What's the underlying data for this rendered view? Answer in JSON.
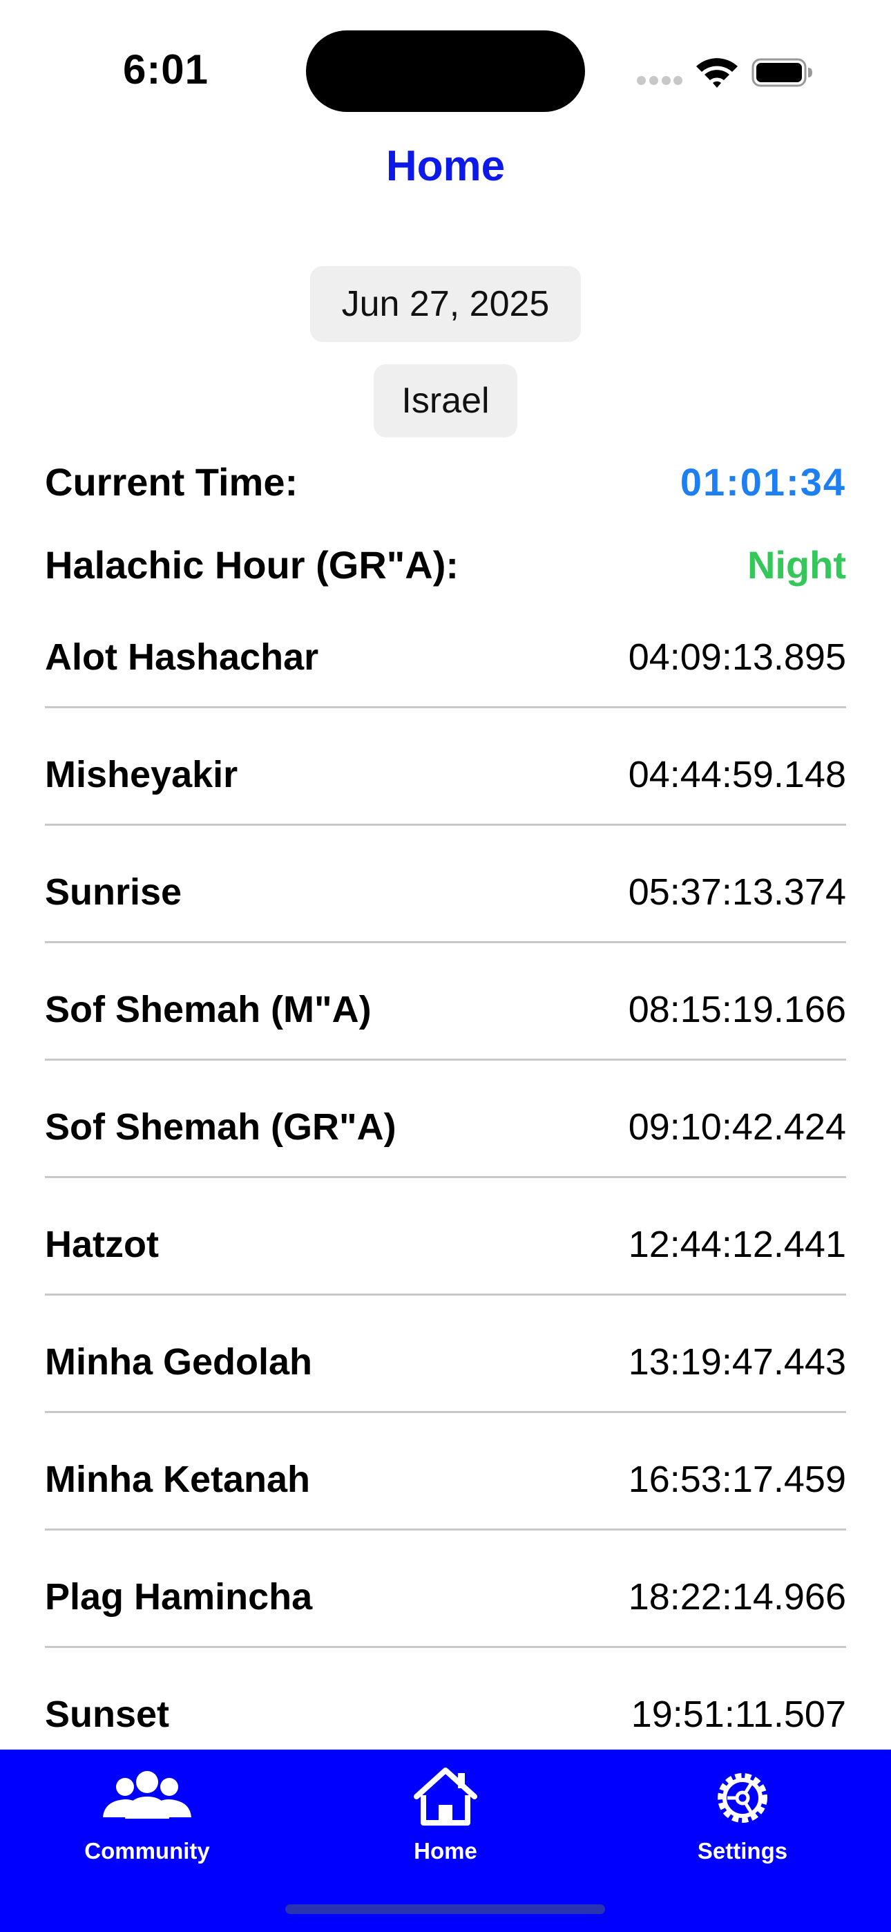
{
  "status_bar": {
    "time": "6:01"
  },
  "navigation": {
    "title": "Home"
  },
  "controls": {
    "date": "Jun 27, 2025",
    "region": "Israel"
  },
  "current_time": {
    "label": "Current Time:",
    "value": "01:01:34"
  },
  "halachic_hour": {
    "label": "Halachic Hour (GR\"A):",
    "value": "Night"
  },
  "zmanim": [
    {
      "name": "Alot Hashachar",
      "time": "04:09:13.895"
    },
    {
      "name": "Misheyakir",
      "time": "04:44:59.148"
    },
    {
      "name": "Sunrise",
      "time": "05:37:13.374"
    },
    {
      "name": "Sof Shemah (M\"A)",
      "time": "08:15:19.166"
    },
    {
      "name": "Sof Shemah (GR\"A)",
      "time": "09:10:42.424"
    },
    {
      "name": "Hatzot",
      "time": "12:44:12.441"
    },
    {
      "name": "Minha Gedolah",
      "time": "13:19:47.443"
    },
    {
      "name": "Minha Ketanah",
      "time": "16:53:17.459"
    },
    {
      "name": "Plag Hamincha",
      "time": "18:22:14.966"
    },
    {
      "name": "Sunset",
      "time": "19:51:11.507"
    }
  ],
  "tab_bar": {
    "tabs": [
      {
        "label": "Community",
        "icon": "community-icon"
      },
      {
        "label": "Home",
        "icon": "home-icon"
      },
      {
        "label": "Settings",
        "icon": "settings-icon"
      }
    ]
  },
  "colors": {
    "accent": "#0000ff",
    "title": "#0c19e8",
    "current_time": "#1e7ff0",
    "night": "#34c759"
  }
}
